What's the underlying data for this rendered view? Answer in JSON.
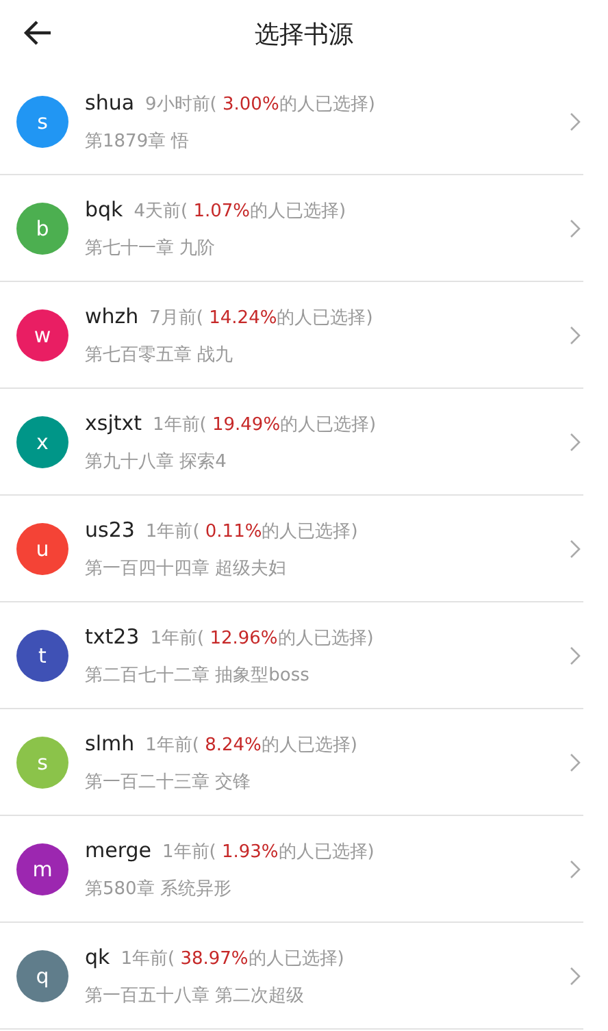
{
  "header": {
    "title": "选择书源"
  },
  "sources": [
    {
      "letter": "s",
      "color": "#2196f3",
      "name": "shua",
      "time": "9小时前(",
      "percent": " 3.00%",
      "suffix": "的人已选择)",
      "chapter": "第1879章 悟"
    },
    {
      "letter": "b",
      "color": "#4caf50",
      "name": "bqk",
      "time": "4天前(",
      "percent": " 1.07%",
      "suffix": "的人已选择)",
      "chapter": "第七十一章 九阶"
    },
    {
      "letter": "w",
      "color": "#e91e63",
      "name": "whzh",
      "time": "7月前(",
      "percent": " 14.24%",
      "suffix": "的人已选择)",
      "chapter": "第七百零五章 战九"
    },
    {
      "letter": "x",
      "color": "#009688",
      "name": "xsjtxt",
      "time": "1年前(",
      "percent": " 19.49%",
      "suffix": "的人已选择)",
      "chapter": "第九十八章 探索4"
    },
    {
      "letter": "u",
      "color": "#f44336",
      "name": "us23",
      "time": "1年前(",
      "percent": " 0.11%",
      "suffix": "的人已选择)",
      "chapter": "第一百四十四章 超级夫妇"
    },
    {
      "letter": "t",
      "color": "#3f51b5",
      "name": "txt23",
      "time": "1年前(",
      "percent": " 12.96%",
      "suffix": "的人已选择)",
      "chapter": "第二百七十二章 抽象型boss"
    },
    {
      "letter": "s",
      "color": "#8bc34a",
      "name": "slmh",
      "time": "1年前(",
      "percent": " 8.24%",
      "suffix": "的人已选择)",
      "chapter": "第一百二十三章 交锋"
    },
    {
      "letter": "m",
      "color": "#9c27b0",
      "name": "merge",
      "time": "1年前(",
      "percent": " 1.93%",
      "suffix": "的人已选择)",
      "chapter": "第580章 系统异形"
    },
    {
      "letter": "q",
      "color": "#607d8b",
      "name": "qk",
      "time": "1年前(",
      "percent": " 38.97%",
      "suffix": "的人已选择)",
      "chapter": "第一百五十八章 第二次超级"
    }
  ]
}
